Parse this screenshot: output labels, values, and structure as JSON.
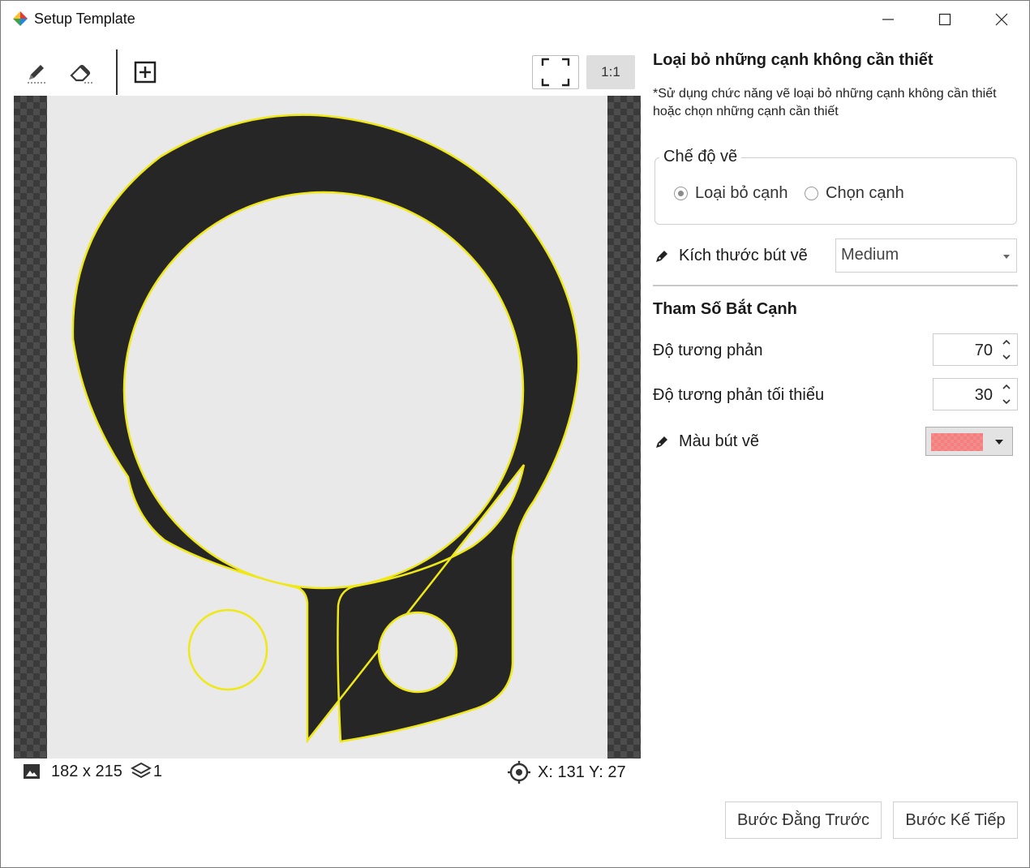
{
  "window": {
    "title": "Setup Template",
    "controls": [
      "minimize-icon",
      "maximize-icon",
      "close-icon"
    ]
  },
  "toolbar": {
    "tools": [
      "pencil-icon",
      "eraser-icon",
      "add-box-icon"
    ],
    "fit_icon": "fullscreen-icon",
    "zoom_1to1_label": "1:1"
  },
  "canvas": {
    "edge_color": "#f0e814",
    "part_color": "#262626",
    "background_color": "#e9e9e9"
  },
  "status": {
    "image_size": "182 x 215",
    "layer_count": "1",
    "cursor_position": "X: 131 Y: 27"
  },
  "panel": {
    "title": "Loại bỏ những cạnh không cần thiết",
    "note": "*Sử dụng chức năng vẽ loại bỏ những cạnh không cần thiết hoặc chọn những cạnh cần thiết",
    "draw_mode": {
      "legend": "Chế độ vẽ",
      "options": [
        {
          "label": "Loại bỏ cạnh",
          "selected": true
        },
        {
          "label": "Chọn cạnh",
          "selected": false
        }
      ]
    },
    "brush_size": {
      "label": "Kích thước bút vẽ",
      "value": "Medium"
    },
    "edge_params": {
      "title": "Tham Số Bắt Cạnh",
      "contrast": {
        "label": "Độ tương phản",
        "value": "70"
      },
      "min_contrast": {
        "label": "Độ tương phản tối thiểu",
        "value": "30"
      }
    },
    "brush_color": {
      "label": "Màu bút vẽ",
      "color": "#f28d8d"
    }
  },
  "footer": {
    "prev_label": "Bước Đằng Trước",
    "next_label": "Bước Kế Tiếp"
  }
}
